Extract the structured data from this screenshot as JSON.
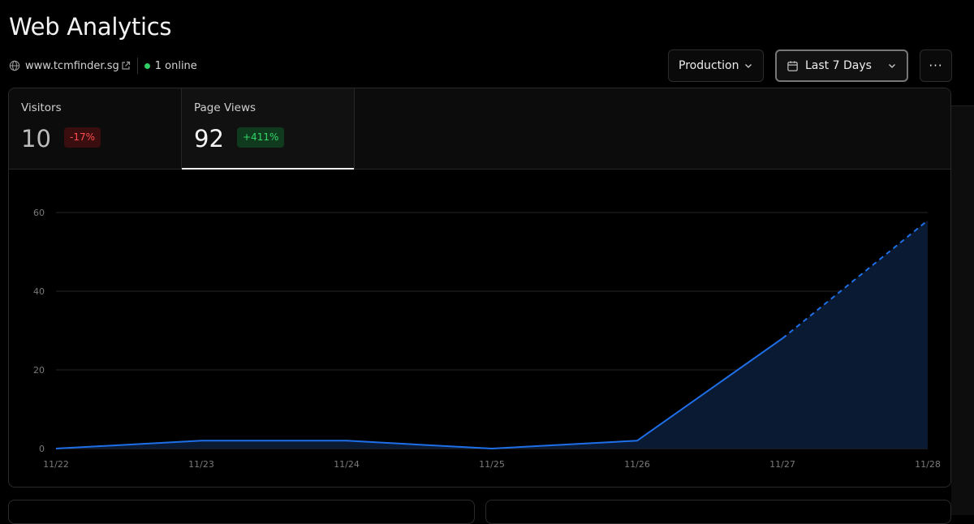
{
  "page": {
    "title": "Web Analytics"
  },
  "site": {
    "domain": "www.tcmfinder.sg",
    "online": "1 online"
  },
  "controls": {
    "environment": "Production",
    "range": "Last 7 Days",
    "more": "···"
  },
  "tabs": [
    {
      "label": "Visitors",
      "value": "10",
      "change": "-17%"
    },
    {
      "label": "Page Views",
      "value": "92",
      "change": "+411%"
    }
  ],
  "colors": {
    "line": "#1f6fe8",
    "area": "#0a1a33",
    "positive": "#35d46a",
    "negative": "#ff4d4f"
  },
  "chart_data": {
    "type": "area",
    "categories": [
      "11/22",
      "11/23",
      "11/24",
      "11/25",
      "11/26",
      "11/27",
      "11/28"
    ],
    "series": [
      {
        "values": [
          0,
          2,
          2,
          0,
          2,
          28,
          58
        ],
        "dashed_from_index": 5
      }
    ],
    "ylim": [
      0,
      60
    ],
    "yticks": [
      0,
      20,
      40,
      60
    ],
    "grid": true
  }
}
